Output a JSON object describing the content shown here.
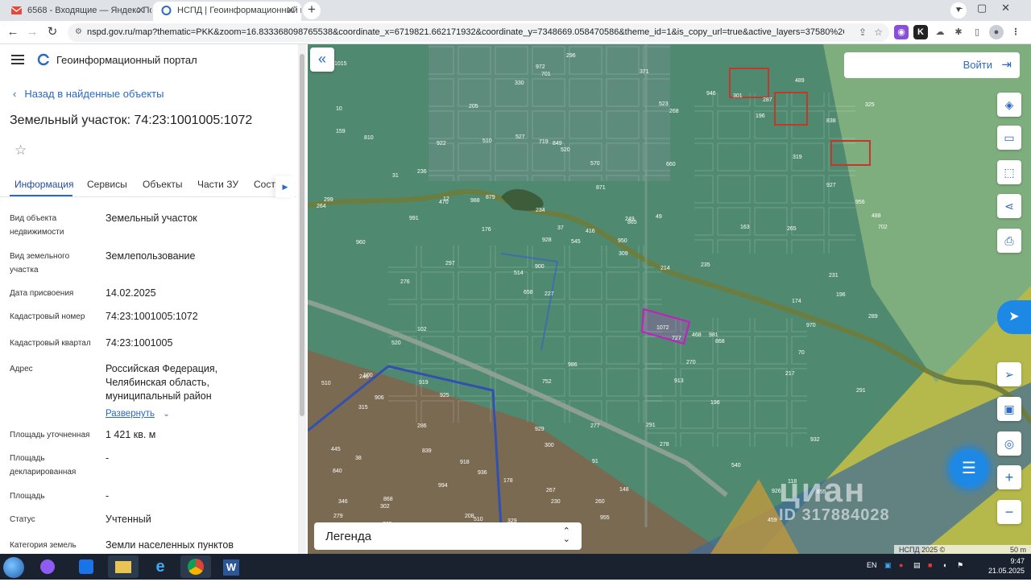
{
  "browser": {
    "tabs": [
      {
        "label": "6568 - Входящие — Яндекс Почта",
        "active": false
      },
      {
        "label": "НСПД | Геоинформационный портал",
        "active": true
      }
    ],
    "url": "nspd.gov.ru/map?thematic=PKK&zoom=16.833368098765538&coordinate_x=6719821.662171932&coordinate_y=7348669.058470586&theme_id=1&is_copy_url=true&active_layers=37580%2C3757..."
  },
  "portal": {
    "title": "Геоинформационный портал",
    "back_label": "Назад в найденные объекты",
    "object_title": "Земельный участок: 74:23:1001005:1072"
  },
  "tabs": [
    "Информация",
    "Сервисы",
    "Объекты",
    "Части ЗУ",
    "Соста"
  ],
  "fields": [
    {
      "label": "Вид объекта недвижимости",
      "value": "Земельный участок"
    },
    {
      "label": "Вид земельного участка",
      "value": "Землепользование"
    },
    {
      "label": "Дата присвоения",
      "value": "14.02.2025"
    },
    {
      "label": "Кадастровый номер",
      "value": "74:23:1001005:1072"
    },
    {
      "label": "Кадастровый квартал",
      "value": "74:23:1001005"
    },
    {
      "label": "Адрес",
      "value": "Российская Федерация, Челябинская область, муниципальный район"
    },
    {
      "label": "Площадь уточненная",
      "value": "1 421 кв. м"
    },
    {
      "label": "Площадь декларированная",
      "value": "-"
    },
    {
      "label": "Площадь",
      "value": "-"
    },
    {
      "label": "Статус",
      "value": "Учтенный"
    },
    {
      "label": "Категория земель",
      "value": "Земли населенных пунктов"
    }
  ],
  "expand_label": "Развернуть",
  "map": {
    "login_label": "Войти",
    "legend_label": "Легенда",
    "attribution": "НСПД 2025 ©",
    "scale": "50 m",
    "watermark_brand": "циан",
    "watermark_id": "ID 317884028",
    "selected_plot": "1072",
    "plot_labels": [
      "855",
      "960",
      "838",
      "658",
      "660",
      "868",
      "719",
      "871",
      "906",
      "879",
      "840",
      "839",
      "849",
      "865",
      "868",
      "810",
      "701",
      "702",
      "727",
      "927",
      "900",
      "929",
      "928",
      "922",
      "946",
      "925",
      "926",
      "932",
      "981",
      "955",
      "988",
      "991",
      "913",
      "994",
      "956",
      "950",
      "346",
      "300",
      "309",
      "315",
      "319",
      "325",
      "270",
      "278",
      "286",
      "285",
      "279",
      "277",
      "287",
      "296",
      "297",
      "299",
      "236",
      "301",
      "302",
      "371",
      "330",
      "37",
      "291",
      "752",
      "936",
      "468",
      "470",
      "445",
      "1015",
      "31",
      "289",
      "234",
      "91",
      "416",
      "38",
      "214",
      "70",
      "267",
      "265",
      "986",
      "540",
      "260",
      "291",
      "972",
      "196",
      "49",
      "196",
      "545",
      "217",
      "264",
      "230",
      "523",
      "268",
      "276",
      "208",
      "231",
      "488",
      "520",
      "919",
      "918",
      "249",
      "196",
      "176",
      "174",
      "10",
      "520",
      "514",
      "510",
      "510",
      "227",
      "489",
      "527",
      "329",
      "246",
      "459",
      "570",
      "510",
      "235",
      "102",
      "118",
      "178",
      "163",
      "159",
      "100",
      "148",
      "12",
      "205",
      "970"
    ]
  },
  "taskbar": {
    "time": "9:47",
    "date": "21.05.2025",
    "lang": "EN"
  }
}
